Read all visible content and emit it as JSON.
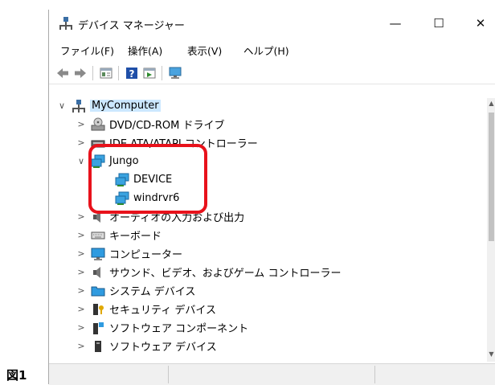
{
  "figure_label": "図1",
  "window": {
    "title": "デバイス マネージャー",
    "minimize": "—",
    "maximize": "☐",
    "close": "✕"
  },
  "menu": [
    {
      "label": "ファイル(F)"
    },
    {
      "label": "操作(A)"
    },
    {
      "label": "表示(V)"
    },
    {
      "label": "ヘルプ(H)"
    }
  ],
  "toolbar_icons": [
    "back-icon",
    "forward-icon",
    "properties-icon",
    "help-icon",
    "update-driver-icon",
    "monitor-icon"
  ],
  "tree": {
    "root": "MyComputer",
    "items": [
      {
        "label": "DVD/CD-ROM ドライブ",
        "icon": "dvd-drive-icon",
        "expanded": false
      },
      {
        "label": "IDE ATA/ATAPI コントローラー",
        "icon": "ide-controller-icon",
        "expanded": false
      },
      {
        "label": "Jungo",
        "icon": "network-icon",
        "expanded": true,
        "children": [
          "DEVICE",
          "windrvr6"
        ]
      },
      {
        "label": "オーディオの入力および出力",
        "icon": "speaker-icon",
        "expanded": false
      },
      {
        "label": "キーボード",
        "icon": "keyboard-icon",
        "expanded": false
      },
      {
        "label": "コンピューター",
        "icon": "monitor-icon",
        "expanded": false
      },
      {
        "label": "サウンド、ビデオ、およびゲーム コントローラー",
        "icon": "speaker-icon",
        "expanded": false
      },
      {
        "label": "システム デバイス",
        "icon": "folder-icon",
        "expanded": false
      },
      {
        "label": "セキュリティ デバイス",
        "icon": "security-key-icon",
        "expanded": false
      },
      {
        "label": "ソフトウェア コンポーネント",
        "icon": "software-component-icon",
        "expanded": false
      },
      {
        "label": "ソフトウェア デバイス",
        "icon": "software-device-icon",
        "expanded": false
      }
    ]
  },
  "colors": {
    "highlight": "#e8121b",
    "selection": "#cce8ff"
  }
}
